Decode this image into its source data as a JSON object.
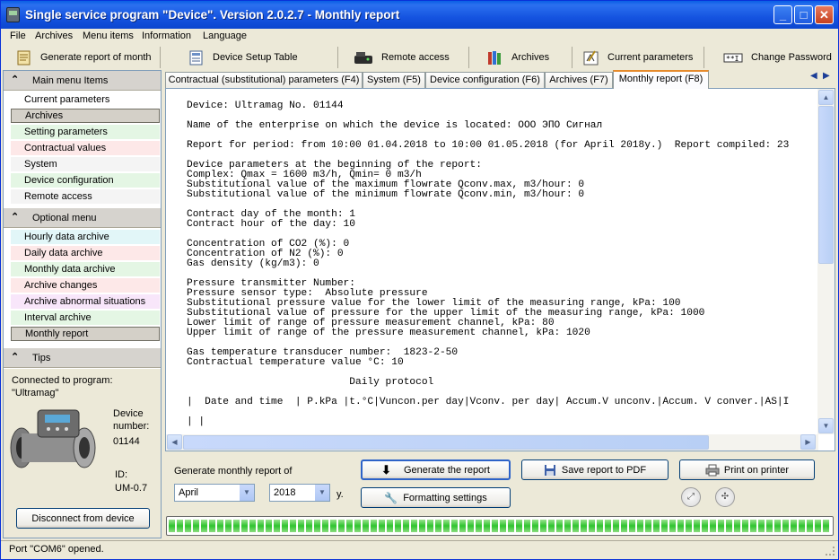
{
  "window": {
    "title": "Single service program \"Device\".   Version 2.0.2.7 - Monthly report",
    "minimize": "_",
    "maximize": "□",
    "close": "✕"
  },
  "menu": [
    "File",
    "Archives",
    "Menu items",
    "Information",
    "Language"
  ],
  "toolbar": [
    {
      "label": "Generate report of month",
      "icon": "report-icon"
    },
    {
      "label": "Device Setup Table",
      "icon": "table-icon"
    },
    {
      "label": "Remote access",
      "icon": "modem-icon"
    },
    {
      "label": "Archives",
      "icon": "archive-icon"
    },
    {
      "label": "Current parameters",
      "icon": "parameters-icon"
    },
    {
      "label": "Change Password",
      "icon": "password-icon"
    }
  ],
  "sidebar": {
    "main_header": "Main menu Items",
    "main_items": [
      {
        "label": "Current parameters",
        "color": "#ffffff"
      },
      {
        "label": "Archives",
        "color": "#d4d0c8"
      },
      {
        "label": "Setting parameters",
        "color": "#e4f6e4"
      },
      {
        "label": "Contractual values",
        "color": "#fde8e8"
      },
      {
        "label": "System",
        "color": "#f4f4f4"
      },
      {
        "label": "Device configuration",
        "color": "#e4f6e4"
      },
      {
        "label": "Remote access",
        "color": "#f4f4f4"
      }
    ],
    "optional_header": "Optional menu",
    "optional_items": [
      {
        "label": "Hourly data archive",
        "color": "#e2f6f8"
      },
      {
        "label": "Daily data archive",
        "color": "#fde8e8"
      },
      {
        "label": "Monthly data archive",
        "color": "#e4f6e4"
      },
      {
        "label": "Archive changes",
        "color": "#fde8e8"
      },
      {
        "label": "Archive abnormal situations",
        "color": "#f8e6fa"
      },
      {
        "label": "Interval archive",
        "color": "#e4f6e4"
      },
      {
        "label": "Monthly report",
        "color": "#d4d0c8"
      }
    ],
    "tips_header": "Tips",
    "connected_line1": "Connected to  program:",
    "connected_line2": "\"Ultramag\"",
    "device_number_label1": "Device",
    "device_number_label2": "number:",
    "device_number": "01144",
    "id_label": "ID:",
    "id_value": "UM-0.7",
    "disconnect_button": "Disconnect from device"
  },
  "tabs": [
    {
      "label": "Contractual (substitutional) parameters (F4)",
      "active": false
    },
    {
      "label": "System (F5)",
      "active": false
    },
    {
      "label": "Device configuration (F6)",
      "active": false
    },
    {
      "label": "Archives (F7)",
      "active": false
    },
    {
      "label": "Monthly report (F8)",
      "active": true
    }
  ],
  "report": {
    "lines": [
      "Device: Ultramag No. 01144",
      "",
      "Name of the enterprise on which the device is located: ООО ЭПО Сигнал",
      "",
      "Report for period: from 10:00 01.04.2018 to 10:00 01.05.2018 (for April 2018y.)  Report compiled: 23",
      "",
      "Device parameters at the beginning of the report:",
      "Complex: Qmax = 1600 m3/h, Qmin= 0 m3/h",
      "Substitutional value of the maximum flowrate Qconv.max, m3/hour: 0",
      "Substitutional value of the minimum flowrate Qconv.min, m3/hour: 0",
      "",
      "Contract day of the month: 1",
      "Contract hour of the day: 10",
      "",
      "Concentration of CO2 (%): 0",
      "Concentration of N2 (%): 0",
      "Gas density (kg/m3): 0",
      "",
      "Pressure transmitter Number:",
      "Pressure sensor type:  Absolute pressure",
      "Substitutional pressure value for the lower limit of the measuring range, kPa: 100",
      "Substitutional value of pressure for the upper limit of the measuring range, kPa: 1000",
      "Lower limit of range of pressure measurement channel, kPa: 80",
      "Upper limit of range of the pressure measurement channel, kPa: 1020",
      "",
      "Gas temperature transducer number:  1823-2-50",
      "Contractual temperature value °C: 10",
      "",
      "                           Daily protocol",
      "",
      "|  Date and time  | P.kPa |t.°C|Vuncon.per day|Vconv. per day| Accum.V unconv.|Accum. V conver.|AS|I",
      "",
      "| |"
    ]
  },
  "controls": {
    "generate_label": "Generate monthly report of",
    "month": "April",
    "year": "2018",
    "year_suffix": "y.",
    "generate_button": "Generate the report",
    "formatting_button": "Formatting settings",
    "save_pdf_button": "Save report to PDF",
    "print_button": "Print on printer"
  },
  "status": {
    "text": "Port \"COM6\" opened.",
    "progress_percent": 100
  }
}
